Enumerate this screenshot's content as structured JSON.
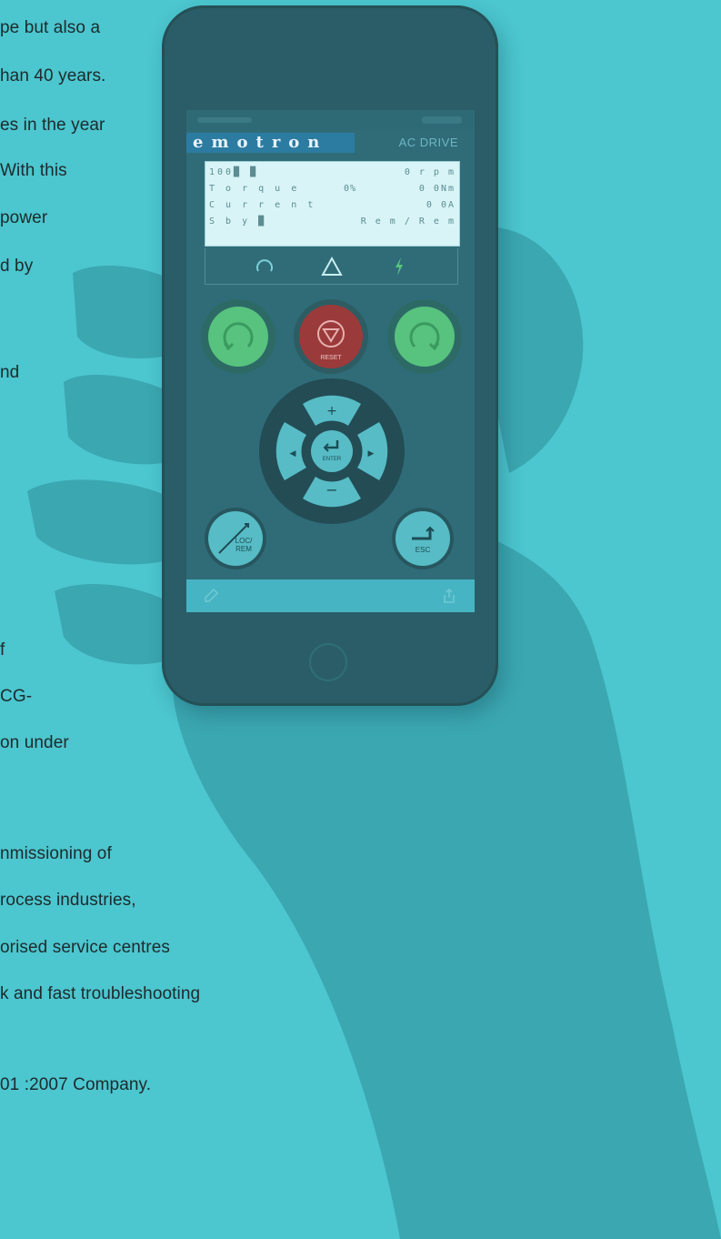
{
  "colors": {
    "background": "#4cc6cf",
    "phone_body": "#2a5d67",
    "hand": "#3aa6b0",
    "run_green": "#57c37e",
    "stop_red": "#9b3a3a",
    "lcd_bg": "#d8f4f6",
    "brand_blue": "#2c7ba1"
  },
  "body_text": [
    "pe but also a",
    "han 40 years.",
    "es in the year",
    "With  this",
    "power",
    "d by",
    "nd",
    "f",
    "CG-",
    "on under",
    "nmissioning  of",
    "rocess industries,",
    "orised service centres",
    "k and fast troubleshooting",
    "01 :2007 Company."
  ],
  "app": {
    "brand": "emotron",
    "subtitle": "AC DRIVE",
    "lcd": {
      "row1": {
        "left": "100█  █",
        "right": "0 r p m"
      },
      "row2": {
        "left": "T o r q u e",
        "mid": "0%",
        "right": "0  0Nm"
      },
      "row3": {
        "left": "C u r r e n t",
        "right": "0  0A"
      },
      "row4": {
        "left": "S b y █",
        "right": "R e m / R e m"
      }
    },
    "status_icons": [
      "rotation-icon",
      "warning-triangle-icon",
      "lightning-icon"
    ],
    "buttons": {
      "reset_label": "RESET",
      "enter_label": "ENTER",
      "plus_label": "+",
      "minus_label": "−",
      "left_label": "◀",
      "right_label": "▶",
      "loc_rem_label": "LOC/ REM",
      "esc_label": "ESC"
    }
  }
}
